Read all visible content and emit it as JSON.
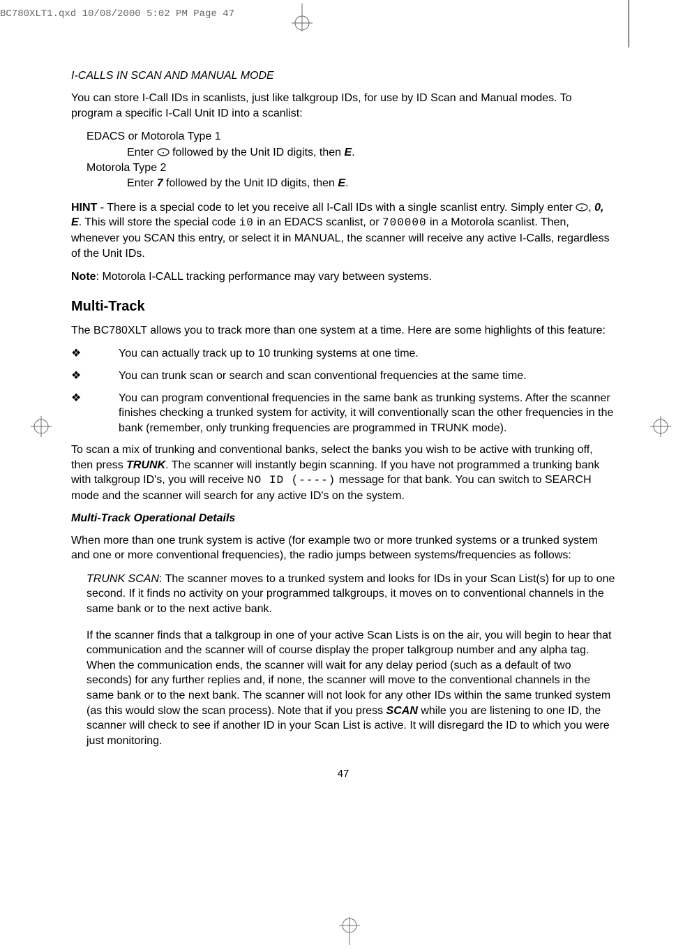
{
  "prepress": "BC780XLT1.qxd  10/08/2000  5:02 PM  Page 47",
  "h_icalls": "I-CALLS IN SCAN AND MANUAL MODE",
  "p1": "You can store I-Call IDs in scanlists, just like talkgroup IDs, for use by ID Scan and Manual modes. To program a specific I-Call Unit ID into a scanlist:",
  "edacs_label": "EDACS or Motorola Type 1",
  "edacs_enter_a": "Enter ",
  "edacs_enter_b": " followed by the Unit ID digits, then ",
  "edacs_key": "E",
  "moto_label": "Motorola Type 2",
  "moto_enter_a": "Enter ",
  "moto_key7": "7",
  "moto_enter_b": " followed by the Unit ID digits, then ",
  "moto_keyE": "E",
  "hint_label": "HINT",
  "hint_a": " - There is a special code to let you receive all I-Call IDs with a single scanlist entry. Simply enter ",
  "hint_b": ", ",
  "hint_keys": "0, E",
  "hint_c": ". This will store the special code ",
  "hint_code1": "i0",
  "hint_d": " in an EDACS scanlist, or ",
  "hint_code2": "700000",
  "hint_e": " in a Motorola scanlist. Then, whenever you SCAN this entry, or select it in MANUAL, the scanner will receive any active I-Calls, regardless of the Unit IDs.",
  "note_label": "Note",
  "note_text": ": Motorola I-CALL tracking performance may vary between systems.",
  "h_multi": "Multi-Track",
  "p_multi": "The BC780XLT allows you to track more than one system at a time. Here are some highlights of this feature:",
  "bullets": [
    "You can actually track up to 10 trunking systems at one time.",
    "You can trunk scan or search and scan conventional frequencies at the same time.",
    "You can program conventional frequencies in the same bank as trunking systems. After the scanner finishes checking a trunked system for activity, it will conventionally scan the other frequencies in the bank (remember, only trunking frequencies are programmed in TRUNK mode)."
  ],
  "p_mixscan_a": "To scan a mix of trunking and conventional banks, select the banks you wish to be active with trunking off, then press ",
  "trunk_key": "TRUNK",
  "p_mixscan_b": ". The scanner will instantly begin scanning. If you have not programmed a trunking bank with talkgroup ID's, you will receive ",
  "noid": "NO ID (----)",
  "p_mixscan_c": " message for that bank. You can switch to SEARCH mode and the scanner will search for any active ID's on the system.",
  "h_details": "Multi-Track Operational Details",
  "p_details": "When more than one trunk system is active (for example two or more trunked systems or a trunked system and one or more conventional frequencies), the radio jumps between systems/frequencies as follows:",
  "trunkscan_label": "TRUNK SCAN",
  "trunkscan_text": ": The scanner moves to a trunked system and looks for IDs in your Scan List(s) for up to one second. If it finds no activity on your programmed talkgroups, it moves on to conventional channels in the same bank or to the next active bank.",
  "p_last_a": "If the scanner finds that a talkgroup in one of your active Scan Lists is on the air, you will begin to hear that communication and the scanner will of course display the proper talkgroup number and any alpha tag. When the communication ends, the scanner will wait for any delay period (such as a default of two seconds) for any further replies and, if none, the scanner will move to the conventional channels in the same bank or to the next bank. The scanner will not look for any other IDs within the same trunked system (as this would slow the scan process). Note that if you press ",
  "scan_key": "SCAN",
  "p_last_b": " while you are listening to one ID, the scanner will check to see if another ID in your Scan List is active. It will disregard the ID to which you were just monitoring.",
  "pagenum": "47"
}
